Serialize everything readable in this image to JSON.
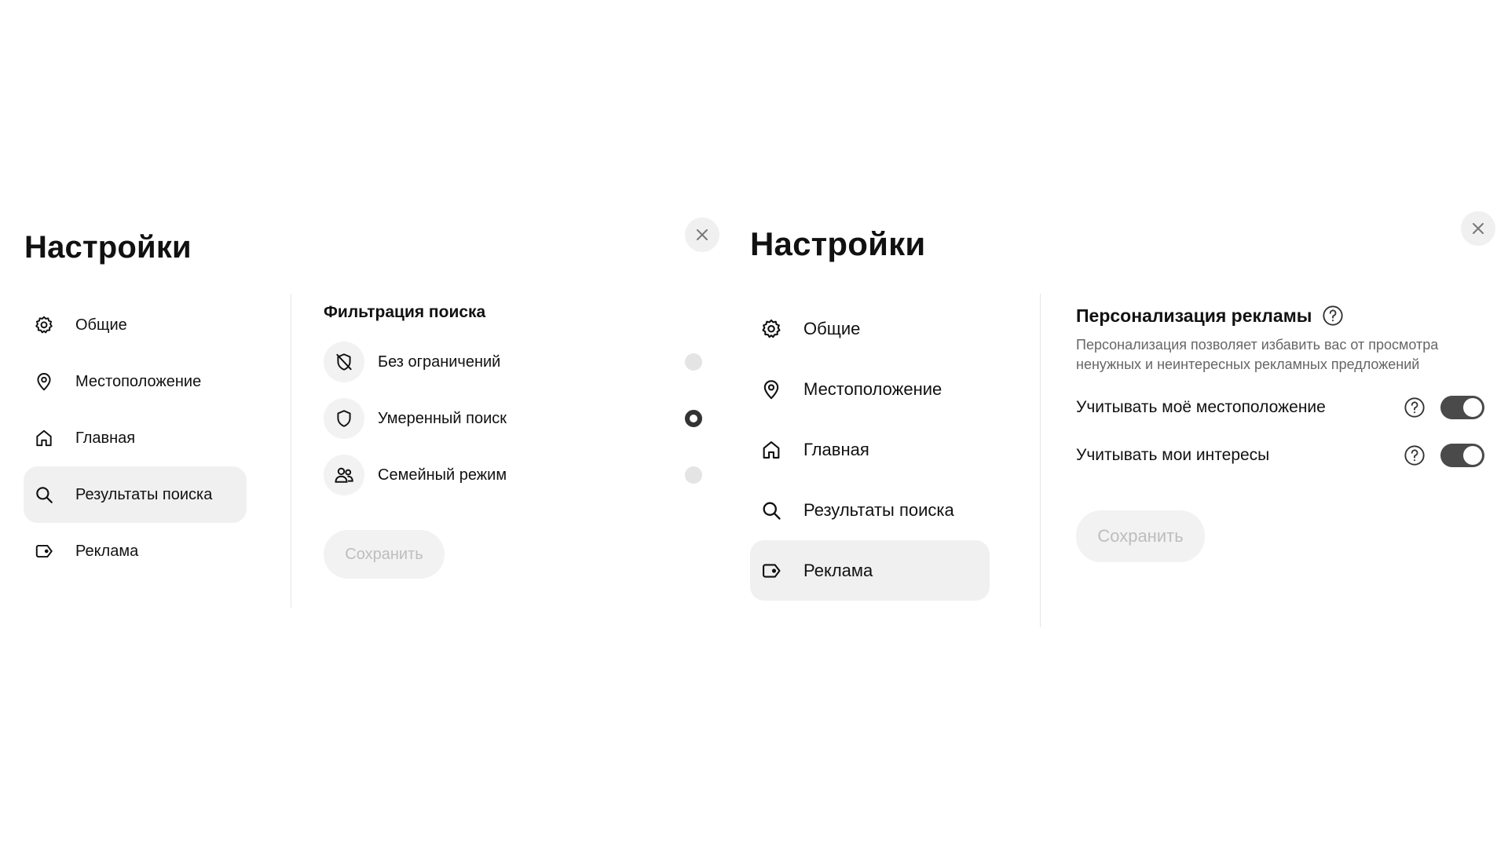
{
  "left_panel": {
    "title": "Настройки",
    "close_icon": "close-icon",
    "nav": [
      {
        "label": "Общие",
        "icon": "gear-icon"
      },
      {
        "label": "Местоположение",
        "icon": "location-pin-icon"
      },
      {
        "label": "Главная",
        "icon": "home-icon"
      },
      {
        "label": "Результаты поиска",
        "icon": "search-icon",
        "active": true
      },
      {
        "label": "Реклама",
        "icon": "ad-tag-icon"
      }
    ],
    "section_title": "Фильтрация поиска",
    "options": [
      {
        "label": "Без ограничений",
        "icon": "shield-off-icon",
        "selected": false
      },
      {
        "label": "Умеренный поиск",
        "icon": "shield-icon",
        "selected": true
      },
      {
        "label": "Семейный режим",
        "icon": "family-icon",
        "selected": false
      }
    ],
    "save_label": "Сохранить"
  },
  "right_panel": {
    "title": "Настройки",
    "close_icon": "close-icon",
    "nav": [
      {
        "label": "Общие",
        "icon": "gear-icon"
      },
      {
        "label": "Местоположение",
        "icon": "location-pin-icon"
      },
      {
        "label": "Главная",
        "icon": "home-icon"
      },
      {
        "label": "Результаты поиска",
        "icon": "search-icon"
      },
      {
        "label": "Реклама",
        "icon": "ad-tag-icon",
        "active": true
      }
    ],
    "section_title": "Персонализация рекламы",
    "description": "Персонализация позволяет избавить вас от просмотра ненужных и неинтересных рекламных предложений",
    "settings": [
      {
        "label": "Учитывать моё местоположение",
        "enabled": true
      },
      {
        "label": "Учитывать мои интересы",
        "enabled": true
      }
    ],
    "save_label": "Сохранить"
  },
  "colors": {
    "text": "#111111",
    "muted_text": "#666666",
    "active_bg": "#f0f0f0",
    "toggle_on": "#4a4a4a",
    "disabled_text": "#bdbdbd"
  }
}
